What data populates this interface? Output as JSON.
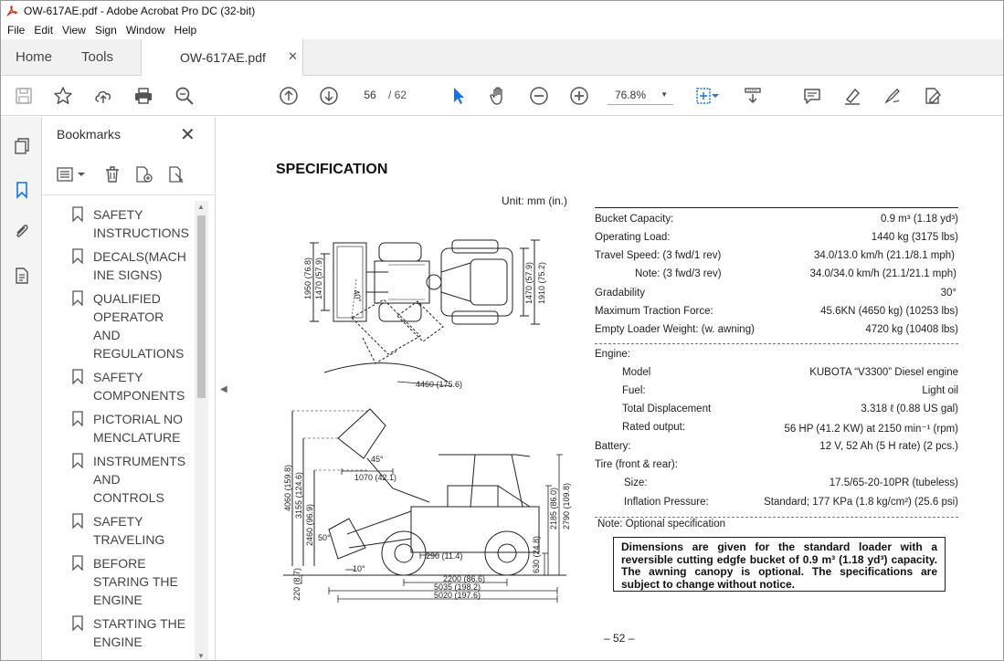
{
  "window": {
    "title": "OW-617AE.pdf - Adobe Acrobat Pro DC (32-bit)"
  },
  "menu": [
    "File",
    "Edit",
    "View",
    "Sign",
    "Window",
    "Help"
  ],
  "tabs": {
    "home": "Home",
    "tools": "Tools",
    "document": "OW-617AE.pdf",
    "close": "✕"
  },
  "toolbar": {
    "current_page": "56",
    "page_total": "/ 62",
    "zoom": "76.8%",
    "accent_color": "#1473e6"
  },
  "bookmarks": {
    "title": "Bookmarks",
    "close": "✕",
    "items": [
      "SAFETY INSTRUCTIONS",
      "DECALS(MACHINE SIGNS)",
      "QUALIFIED OPERATOR AND REGULATIONS",
      "SAFETY COMPONENTS",
      "PICTORIAL NOMENCLATURE",
      "INSTRUMENTS AND CONTROLS",
      "SAFETY TRAVELING",
      "BEFORE STARING THE ENGINE",
      "STARTING THE ENGINE"
    ]
  },
  "page": {
    "heading": "SPECIFICATION",
    "unit": "Unit: mm (in.)",
    "specs": [
      {
        "label": "Bucket Capacity:",
        "value": "0.9 m³ (1.18 yd³)"
      },
      {
        "label": "Operating Load:",
        "value": "1440 kg (3175 lbs)"
      },
      {
        "label": "Travel Speed:  (3 fwd/1 rev)",
        "value": "34.0/13.0 km/h (21.1/8.1 mph)"
      },
      {
        "label": "Note:  (3 fwd/3 rev)",
        "value": "34.0/34.0 km/h (21.1/21.1 mph)"
      },
      {
        "label": "Gradability",
        "value": "30°"
      },
      {
        "label": "Maximum Traction Force:",
        "value": "45.6KN (4650 kg) (10253 lbs)"
      },
      {
        "label": "Empty Loader Weight:  (w. awning)",
        "value": "4720 kg (10408 lbs)"
      }
    ],
    "engine_label": "Engine:",
    "engine": [
      {
        "label": "Model",
        "value": "KUBOTA “V3300” Diesel engine"
      },
      {
        "label": "Fuel:",
        "value": "Light oil"
      },
      {
        "label": "Total Displacement",
        "value": "3.318 ℓ (0.88 US gal)"
      },
      {
        "label": "Rated output:",
        "value": "56 HP (41.2 KW) at 2150 min⁻¹ (rpm)"
      }
    ],
    "battery": {
      "label": "Battery:",
      "value": "12 V, 52 Ah (5 H rate) (2 pcs.)"
    },
    "tire_label": "Tire (front & rear):",
    "tire": [
      {
        "label": "Size:",
        "value": "17.5/65-20-10PR (tubeless)"
      },
      {
        "label": "Inflation Pressure:",
        "value": "Standard; 177 KPa (1.8 kg/cm²) (25.6 psi)"
      }
    ],
    "note": "Note: Optional specification",
    "dimensions_note": "Dimensions are given for the standard loader with a reversible cutting edgfe bucket of 0.9 m³ (1.18 yd³) capacity.  The awning canopy is optional.  The specifications are subject to change without notice.",
    "page_number": "– 52 –",
    "top_view_dims": {
      "left_outer": "1950 (76.8)",
      "left_inner": "1470 (57.9)",
      "angle": "40°",
      "right_inner": "1470 (57.9)",
      "right_outer": "1910 (75.2)",
      "turning_radius": "4460 (175.6)"
    },
    "side_view_dims": {
      "height_max": "4060 (159.8)",
      "height_pin": "3155 (124.6)",
      "height_dump": "2460 (96.9)",
      "dump_angle": "45°",
      "reach": "1070 (42.1)",
      "rollback": "50°",
      "dig_depth": "220 (8.7)",
      "bucket_tilt": "10°",
      "clearance": "290 (11.4)",
      "wheelbase": "2200 (86.6)",
      "length_a": "5035 (198.2)",
      "length_b": "5020 (197.6)",
      "ground": "630 (24.8)",
      "canopy_h": "2185 (86.0)",
      "canopy_top": "2790 (109.8)"
    }
  }
}
